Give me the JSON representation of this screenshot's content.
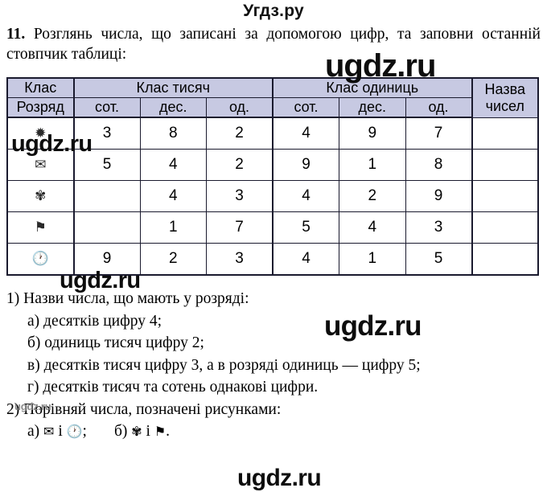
{
  "banner": {
    "text": "Угдз.ру"
  },
  "statement": {
    "number": "11.",
    "text": " Розглянь числа, що записані за допомогою цифр, та заповни останній стовпчик таблиці:"
  },
  "table": {
    "header_top": [
      {
        "label": "Клас",
        "colspan": 1
      },
      {
        "label": "Клас тисяч",
        "colspan": 3
      },
      {
        "label": "Клас одиниць",
        "colspan": 3
      },
      {
        "label": "Назва чисел",
        "colspan": 1,
        "rowspan": 2
      }
    ],
    "header_bottom": [
      "Розряд",
      "сот.",
      "дес.",
      "од.",
      "сот.",
      "дес.",
      "од."
    ],
    "last_col_line1": "Назва",
    "last_col_line2": "чисел",
    "rows": [
      {
        "icon": "star-icon",
        "glyph": "✹",
        "cells": [
          "3",
          "8",
          "2",
          "4",
          "9",
          "7"
        ],
        "name": ""
      },
      {
        "icon": "envelope-icon",
        "glyph": "✉",
        "cells": [
          "5",
          "4",
          "2",
          "9",
          "1",
          "8"
        ],
        "name": ""
      },
      {
        "icon": "flower-icon",
        "glyph": "✾",
        "cells": [
          "",
          "4",
          "3",
          "4",
          "2",
          "9"
        ],
        "name": ""
      },
      {
        "icon": "flag-icon",
        "glyph": "⚑",
        "cells": [
          "",
          "1",
          "7",
          "5",
          "4",
          "3"
        ],
        "name": ""
      },
      {
        "icon": "clock-icon",
        "glyph": "🕐",
        "cells": [
          "9",
          "2",
          "3",
          "4",
          "1",
          "5"
        ],
        "name": ""
      }
    ]
  },
  "questions": {
    "q1": "1) Назви числа, що мають у розряді:",
    "q1a": "а) десятків цифру 4;",
    "q1b": "б) одиниць тисяч цифру 2;",
    "q1v": "в) десятків тисяч цифру 3, а в розряді одиниць — цифру 5;",
    "q1g": "г) десятків тисяч та сотень однакові цифри.",
    "q2": "2) Порівняй числа, позначені рисунками:",
    "q2a_prefix": "а)",
    "q2a_icon1": "✉",
    "q2a_mid": "і",
    "q2a_icon2": "🕐",
    "q2a_suffix": ";",
    "q2b_prefix": "б)",
    "q2b_icon1": "✾",
    "q2b_mid": "і",
    "q2b_icon2": "⚑",
    "q2b_suffix": "."
  },
  "watermarks": {
    "w1": "ugdz.ru",
    "w2": "ugdz.ru",
    "w3": "ugdz.ru",
    "w4": "ugdz.ru",
    "w5": "ugdz.ru",
    "w6": "ugdz.ru"
  },
  "colors": {
    "header_fill": "#c7c9e2",
    "border": "#1a1a2e",
    "text": "#000000",
    "watermark_dark": "#0d0d0d",
    "watermark_faint": "#8a8a8a"
  }
}
